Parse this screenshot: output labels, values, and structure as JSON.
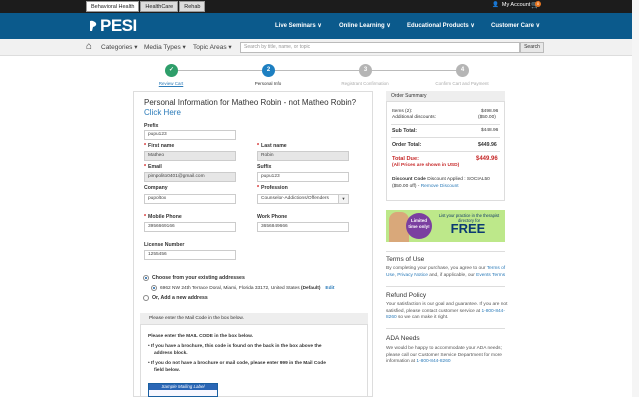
{
  "topbar": {
    "tabs": [
      "Behavioral Health",
      "HealthCare",
      "Rehab"
    ],
    "my_account": "My Account",
    "cart_count": "0"
  },
  "nav": {
    "logo": "PESI",
    "items": [
      "Live Seminars ∨",
      "Online Learning ∨",
      "Educational Products ∨",
      "Customer Care ∨"
    ]
  },
  "subnav": {
    "categories": "Categories ▾",
    "media": "Media Types ▾",
    "topics": "Topic Areas ▾",
    "search_placeholder": "Search by title, name, or topic",
    "search_btn": "Search"
  },
  "steps": [
    {
      "num": "✓",
      "label": "Review Cart"
    },
    {
      "num": "2",
      "label": "Personal Info"
    },
    {
      "num": "3",
      "label": "Registrant Confirmation"
    },
    {
      "num": "4",
      "label": "Confirm Cart and Payment"
    }
  ],
  "form": {
    "title_prefix": "Personal Information for Matheo Robin - not Matheo Robin? ",
    "title_link": "Click Here",
    "prefix_label": "Prefix",
    "prefix_value": "pupu123",
    "first_label": "First name",
    "first_value": "Matheo",
    "last_label": "Last name",
    "last_value": "Robin",
    "email_label": "Email",
    "email_value": "pimpolito0401@gmail.com",
    "suffix_label": "Suffix",
    "suffix_value": "pupu123",
    "company_label": "Company",
    "company_value": "pupoltox",
    "profession_label": "Profession",
    "profession_value": "Counselor-Addictions/Offenders",
    "mobile_label": "Mobile Phone",
    "mobile_value": "3956669166",
    "work_label": "Work Phone",
    "work_value": "3656849666",
    "license_label": "License Number",
    "license_value": "1255456",
    "choose_label": "Choose from your existing addresses",
    "address": "6962 NW 24th Terrace Doral, Miami, Florida 33172, United States",
    "address_default": "(Default)",
    "edit": "Edit",
    "or_add": "Or,  Add a new address",
    "mail_head": "Please enter the Mail Code in the box below.",
    "mail_line1": "Please enter the MAIL CODE in the box below.",
    "mail_line2a": "•  If you have a brochure, this code is found on the back in the box above the",
    "mail_line2b": "address block.",
    "mail_line3a": "•  If you do not have a brochure or mail code, please enter 999 in the Mail Code",
    "mail_line3b": "field below.",
    "sample_label": "Sample Mailing Label"
  },
  "order": {
    "head": "Order Summary",
    "items_label": "Items (2):",
    "items_value": "$498.96",
    "add_disc_label": "Additional discounts:",
    "add_disc_value": "($50.00)",
    "sub_label": "Sub Total:",
    "sub_value": "$448.96",
    "order_total_label": "Order Total:",
    "order_total_value": "$449.96",
    "total_due_label": "Total Due:",
    "total_due_value": "$449.96",
    "usd_note": "(All Prices are shown in USD)",
    "disc_code_label": "Discount Code",
    "disc_code_text": " Discount Applied : SOCIAL50",
    "disc_line2": "($50.00 off) - ",
    "remove": "Remove Discount"
  },
  "ad": {
    "limited": "Limited time only!",
    "top": "List your practice in the therapist directory for",
    "free": "FREE"
  },
  "side": {
    "terms_head": "Terms of Use",
    "terms_text": "By completing your purchase, you agree to our ",
    "terms_link1": "Terms of Use",
    "terms_text2": ", ",
    "terms_link2": "Privacy Notice",
    "terms_text3": " and, if applicable, our ",
    "terms_link3": "Events Terms",
    "refund_head": "Refund Policy",
    "refund_text": "Your satisfaction is our goal and guarantee. If you are not satisfied, please contact customer service at ",
    "refund_phone": "1-800-844-8260",
    "refund_text2": " so we can make it right.",
    "ada_head": "ADA Needs",
    "ada_text": "We would be happy to accommodate your ADA needs; please call our Customer Service Department for more information at ",
    "ada_phone": "1-800-844-8260"
  },
  "colors": {
    "brand_blue": "#0b5a8c",
    "step_done": "#2e9e6a",
    "step_active": "#1d7fc1",
    "step_todo": "#b5b5b5",
    "total_red": "#c62828"
  }
}
